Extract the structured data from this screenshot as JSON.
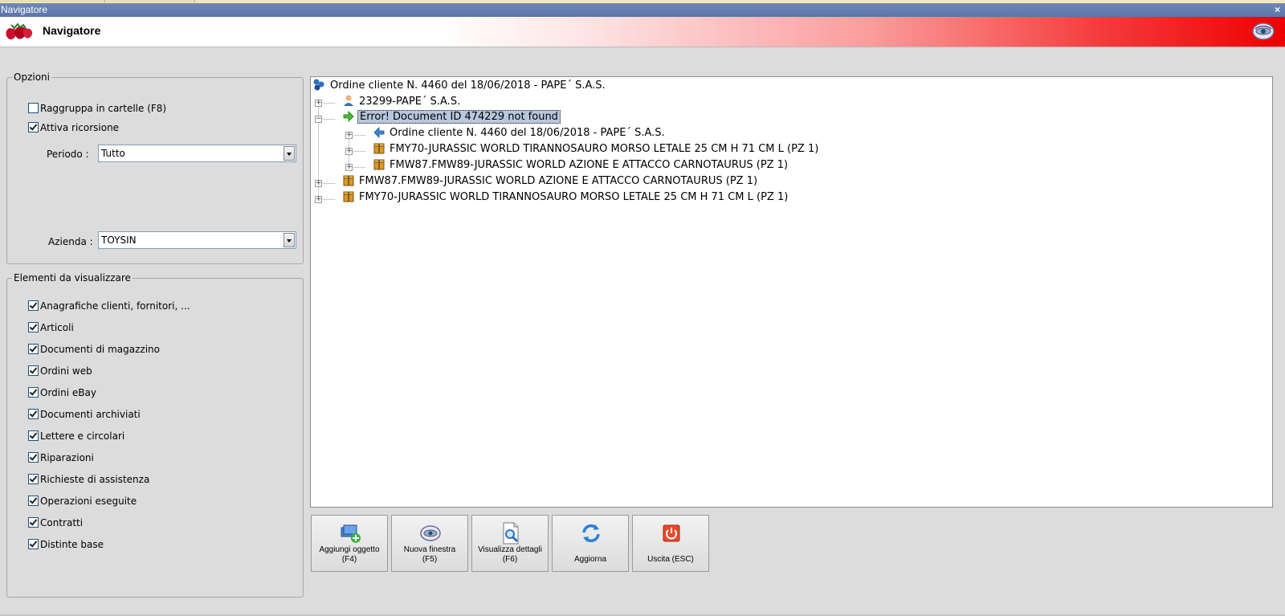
{
  "window": {
    "title": "Navigatore",
    "close_glyph": "×"
  },
  "header": {
    "title": "Navigatore",
    "logo_icon": "strawberries-icon",
    "app_icon": "eye-icon"
  },
  "options": {
    "legend": "Opzioni",
    "group_by_folder": {
      "label": "Raggruppa in cartelle (F8)",
      "checked": false
    },
    "recursion": {
      "label": "Attiva ricorsione",
      "checked": true
    },
    "period": {
      "label": "Periodo :",
      "value": "Tutto"
    },
    "company": {
      "label": "Azienda :",
      "value": "TOYSIN"
    }
  },
  "elements": {
    "legend": "Elementi da visualizzare",
    "items": [
      {
        "label": "Anagrafiche clienti, fornitori, ...",
        "checked": true
      },
      {
        "label": "Articoli",
        "checked": true
      },
      {
        "label": "Documenti di magazzino",
        "checked": true
      },
      {
        "label": "Ordini web",
        "checked": true
      },
      {
        "label": "Ordini eBay",
        "checked": true
      },
      {
        "label": "Documenti archiviati",
        "checked": true
      },
      {
        "label": "Lettere e circolari",
        "checked": true
      },
      {
        "label": "Riparazioni",
        "checked": true
      },
      {
        "label": "Richieste di assistenza",
        "checked": true
      },
      {
        "label": "Operazioni eseguite",
        "checked": true
      },
      {
        "label": "Contratti",
        "checked": true
      },
      {
        "label": "Distinte base",
        "checked": true
      }
    ]
  },
  "tree": {
    "root": "Ordine cliente N. 4460 del 18/06/2018 - PAPE´ S.A.S.",
    "nodes": [
      {
        "text": "23299-PAPE´  S.A.S.",
        "icon": "customer-icon",
        "expander": "+"
      },
      {
        "text": "Error! Document ID 474229 not found",
        "icon": "green-arrow-icon",
        "expander": "−",
        "selected": true
      },
      {
        "text": "Ordine cliente N. 4460 del 18/06/2018 - PAPE´ S.A.S.",
        "icon": "blue-arrow-left-icon",
        "expander": "+"
      },
      {
        "text": "FMY70-JURASSIC WORLD TIRANNOSAURO MORSO LETALE 25 CM H 71 CM L (PZ 1)",
        "icon": "package-icon",
        "expander": "+"
      },
      {
        "text": "FMW87.FMW89-JURASSIC WORLD AZIONE E ATTACCO CARNOTAURUS (PZ 1)",
        "icon": "package-icon",
        "expander": "+"
      },
      {
        "text": "FMW87.FMW89-JURASSIC WORLD AZIONE E ATTACCO CARNOTAURUS (PZ 1)",
        "icon": "package-icon",
        "expander": "+"
      },
      {
        "text": "FMY70-JURASSIC WORLD TIRANNOSAURO MORSO LETALE 25 CM H 71 CM L (PZ 1)",
        "icon": "package-icon",
        "expander": "+"
      }
    ]
  },
  "toolbar": {
    "add": {
      "line1": "Aggiungi oggetto",
      "line2": "(F4)"
    },
    "new_window": {
      "line1": "Nuova finestra",
      "line2": "(F5)"
    },
    "details": {
      "line1": "Visualizza dettagli",
      "line2": "(F6)"
    },
    "refresh": {
      "line1": "Aggiorna",
      "line2": ""
    },
    "exit": {
      "line1": "Uscita (ESC)",
      "line2": ""
    }
  },
  "colors": {
    "selection": "#b7c7dc",
    "header_red": "#ee0000",
    "titlebar": "#5a75a8"
  }
}
